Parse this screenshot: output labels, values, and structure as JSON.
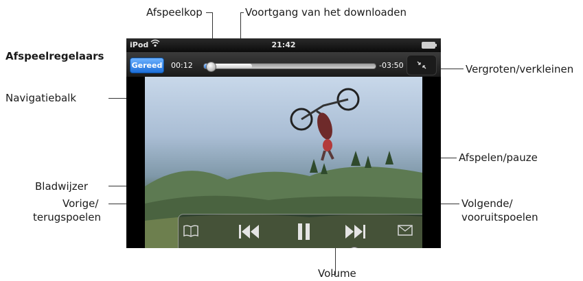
{
  "title": "Afspeelregelaars",
  "callouts": {
    "playhead": "Afspeelkop",
    "download_progress": "Voortgang van het downloaden",
    "zoom": "Vergroten/verkleinen",
    "scrubber": "Navigatiebalk",
    "play_pause": "Afspelen/pauze",
    "bookmark": "Bladwijzer",
    "previous_line1": "Vorige/",
    "previous_line2": "terugspoelen",
    "next_line1": "Volgende/",
    "next_line2": "vooruitspoelen",
    "volume": "Volume"
  },
  "status_bar": {
    "carrier": "iPod",
    "wifi_icon": "wifi-icon",
    "time": "21:42",
    "battery_icon": "battery-icon"
  },
  "player": {
    "done_label": "Gereed",
    "elapsed": "00:12",
    "remaining": "-03:50",
    "playhead_fraction": 0.04,
    "download_fraction": 0.28,
    "volume_fraction": 0.77
  },
  "icons": {
    "bookmark": "bookmark-icon",
    "previous": "previous-icon",
    "pause": "pause-icon",
    "next": "next-icon",
    "mail": "mail-icon",
    "zoom": "zoom-icon"
  },
  "colors": {
    "accent_blue": "#1c6ed9",
    "screen_bg": "#000000"
  }
}
